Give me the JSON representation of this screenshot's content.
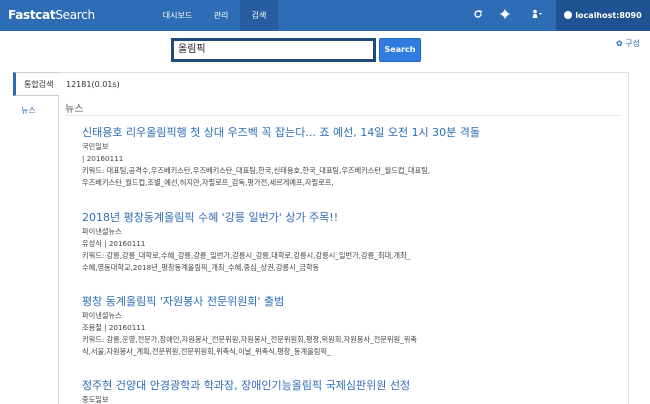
{
  "navbar": {
    "brand_bold": "Fastcat",
    "brand_regular": "Search",
    "menu": [
      "대시보드",
      "관리",
      "검색"
    ],
    "host": "localhost:8090"
  },
  "search": {
    "query": "올림픽",
    "button_label": "Search",
    "config_label": "✿ 구성"
  },
  "sidebar": {
    "tabs": [
      "통합검색",
      "뉴스"
    ]
  },
  "results": {
    "count": "12181(0.01s)",
    "section": "뉴스",
    "items": [
      {
        "title": "신태용호 리우올림픽행 첫 상대 우즈벡 꼭 잡는다... 죠 예선, 14일 오전 1시 30분 격돌",
        "source": "국민일보",
        "meta": "| 20160111",
        "kw1": "키워드: 대표팀,공격수,우즈베키스탄,우즈베키스탄_대표팀,한국,신태용호,한국_대표팀,우즈베키스탄_월드컵_대표팀,",
        "kw2": "우즈베키스탄_월드컵,조별_예선,허지만,자필로프_감독,평가전,세르게예프,자필로프,"
      },
      {
        "title": "2018년 평창동계올림픽 수혜 '강릉 일번가' 상가 주목!!",
        "source": "파이낸셜뉴스",
        "meta": "유성식 | 20160111",
        "kw1": "키워드: 강릉,강릉_대학로,수혜_강릉,강릉_일번가,강릉시_강릉,대학로,강릉시,강릉시_일번가,강릉_최대,개최_",
        "kw2": "수혜,영동대학교,2018년_평창동계올림픽_개최_수혜,중심_상권,강릉시_금학동"
      },
      {
        "title": "평창 동계올림픽 '자원봉사 전문위원회' 출범",
        "source": "파이낸셜뉴스",
        "meta": "조용철 | 20160111",
        "kw1": "키워드: 강릉,운영,전문가,장애인,자원봉사_전문위원,자원봉사_전문위원회,평창,위원회,자원봉사_전문위원_위촉",
        "kw2": "식,서울,자원봉사_계획,전문위원,전문위원회,위촉식,이날_위촉식,평창_동계올림픽_"
      },
      {
        "title": "정주현 건양대 안경광학과 학과장, 장애인기능올림픽 국제심판위원 선정",
        "source": "중도일보"
      }
    ]
  }
}
